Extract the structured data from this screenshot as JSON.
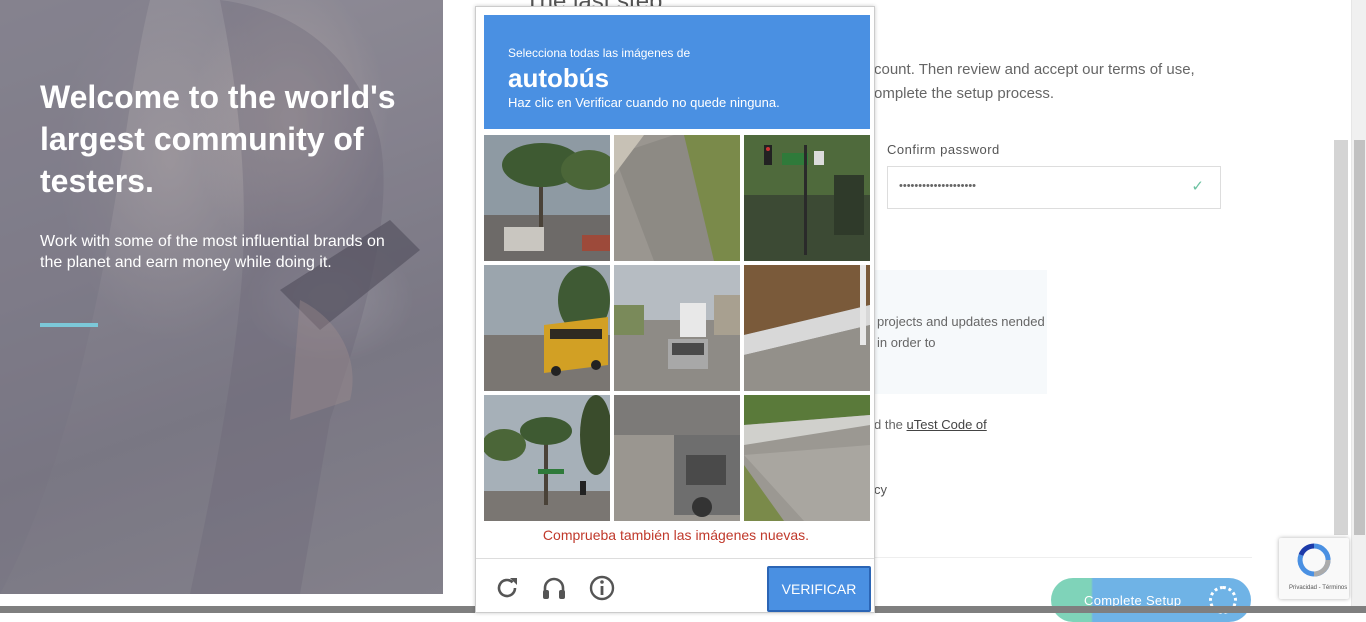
{
  "hero": {
    "title": "Welcome to the world's largest community of testers.",
    "subtitle": "Work with some of the most influential brands on the planet and earn money while doing it."
  },
  "form": {
    "title_partial": "The last step",
    "description": "count. Then review and accept our terms of use, omplete the setup process.",
    "confirm_password_label": "Confirm password",
    "confirm_password_value": "••••••••••••••••••••",
    "info_text": "projects and updates nended in order to",
    "agree_prefix": "d the ",
    "agree_link": "uTest Code of",
    "privacy_partial": "cy",
    "complete_button": "Complete Setup"
  },
  "captcha": {
    "header_small": "Selecciona todas las imágenes de",
    "header_target": "autobús",
    "header_note": "Haz clic en Verificar cuando no quede ninguna.",
    "warning": "Comprueba también las imágenes nuevas.",
    "verify_button": "VERIFICAR",
    "tiles": [
      {
        "name": "palm-street-tile",
        "scene": "palms"
      },
      {
        "name": "road-grass-tile",
        "scene": "road"
      },
      {
        "name": "street-sign-tile",
        "scene": "sign"
      },
      {
        "name": "yellow-bus-tile",
        "scene": "bus"
      },
      {
        "name": "truck-street-tile",
        "scene": "street"
      },
      {
        "name": "roadside-fence-tile",
        "scene": "fence"
      },
      {
        "name": "palm-traffic-tile",
        "scene": "palms2"
      },
      {
        "name": "vehicle-rear-tile",
        "scene": "vehicle"
      },
      {
        "name": "curb-grass-tile",
        "scene": "curb"
      }
    ],
    "icons": [
      "reload-icon",
      "headphones-icon",
      "info-icon"
    ]
  },
  "badge": {
    "text": "Privacidad - Términos"
  },
  "colors": {
    "captcha_blue": "#4a90e2",
    "warning_red": "#c0392b",
    "accent_teal": "#7cc8d8"
  }
}
